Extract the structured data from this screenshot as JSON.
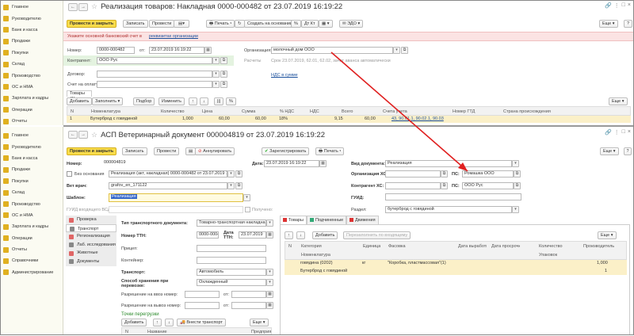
{
  "sidebar_top": [
    {
      "label": "Главное",
      "icon": "home-icon"
    },
    {
      "label": "Руководителю",
      "icon": "chart-icon"
    },
    {
      "label": "Банк и касса",
      "icon": "bank-icon"
    },
    {
      "label": "Продажи",
      "icon": "sales-icon"
    },
    {
      "label": "Покупки",
      "icon": "purchases-icon"
    },
    {
      "label": "Склад",
      "icon": "warehouse-icon"
    },
    {
      "label": "Производство",
      "icon": "production-icon"
    },
    {
      "label": "ОС и НМА",
      "icon": "assets-icon"
    },
    {
      "label": "Зарплата и кадры",
      "icon": "salary-icon"
    },
    {
      "label": "Операции",
      "icon": "operations-icon"
    },
    {
      "label": "Отчеты",
      "icon": "reports-icon"
    }
  ],
  "sidebar_bottom": [
    {
      "label": "Главное",
      "icon": "home-icon"
    },
    {
      "label": "Руководителю",
      "icon": "chart-icon"
    },
    {
      "label": "Банк и касса",
      "icon": "bank-icon"
    },
    {
      "label": "Продажи",
      "icon": "sales-icon"
    },
    {
      "label": "Покупки",
      "icon": "purchases-icon"
    },
    {
      "label": "Склад",
      "icon": "warehouse-icon"
    },
    {
      "label": "Производство",
      "icon": "production-icon"
    },
    {
      "label": "ОС и НМА",
      "icon": "assets-icon"
    },
    {
      "label": "Зарплата и кадры",
      "icon": "salary-icon"
    },
    {
      "label": "Операции",
      "icon": "operations-icon"
    },
    {
      "label": "Отчеты",
      "icon": "reports-icon"
    },
    {
      "label": "Справочники",
      "icon": "catalog-icon"
    },
    {
      "label": "Администрирование",
      "icon": "admin-icon"
    }
  ],
  "top": {
    "title": "Реализация товаров: Накладная 0000-000482 от 23.07.2019 16:19:22",
    "post_close": "Провести и закрыть",
    "write": "Записать",
    "post": "Провести",
    "print": "Печать",
    "create_based": "Создать на основании",
    "edo": "ЭДО",
    "more": "Еще",
    "help": "?",
    "warning_text": "Укажите основной банковский счет в",
    "warning_link": "реквизитах организации",
    "number_label": "Номер:",
    "number": "0000-000482",
    "from_label": "от:",
    "date": "23.07.2019 16:19:22",
    "org_label": "Организация:",
    "org": "молочный дом ООО",
    "counterparty_label": "Контрагент:",
    "counterparty": "ООО Рус",
    "settlements_label": "Расчеты",
    "settlements": "Срок 23.07.2019, 62.01, 62.02, зачет аванса автоматически",
    "contract_label": "Договор:",
    "invoice_label": "Счет на оплату:",
    "vat_link": "НДС в сумме",
    "tab_goods": "Товары (1)",
    "add": "Добавить",
    "fill": "Заполнить",
    "pick": "Подбор",
    "change": "Изменить",
    "more2": "Еще",
    "columns": [
      "N",
      "Номенклатура",
      "Количество",
      "Цена",
      "Сумма",
      "% НДС",
      "НДС",
      "Всего",
      "Счета учета",
      "Номер ГТД",
      "Страна происхождения"
    ],
    "row": {
      "n": "1",
      "item": "Бутерброд с говядиной",
      "qty": "1,000",
      "price": "60,00",
      "sum": "60,00",
      "vat_rate": "18%",
      "vat": "9,15",
      "total": "60,00",
      "accounts": "43, 90.01.1, 90.02.1, 90.03"
    }
  },
  "bottom": {
    "title": "АСП Ветеринарный документ 000004819 от 23.07.2019 16:19:22",
    "post_close": "Провести и закрыть",
    "write": "Записать",
    "post": "Провести",
    "cancel": "Аннулировать",
    "register": "Зарегистрировать",
    "print": "Печать",
    "more": "Еще",
    "help": "?",
    "number_label": "Номер:",
    "number": "000004819",
    "date_label": "Дата:",
    "date": "23.07.2019 16:19:22",
    "doc_type_label": "Вид документа:",
    "doc_type": "Реализация",
    "no_basis": "Без основания",
    "basis": "Реализация (акт, накладная) 0000-000482 от 23.07.2019 1",
    "org_hs_label": "Организация ХС:",
    "ps_label": "ПС:",
    "ps_org": "Ромашка ООО",
    "vet_label": "Вет врач:",
    "vet": "grafov_en_171122",
    "contr_hs_label": "Контрагент ХС:",
    "ps_contr": "ООО Рус",
    "template_label": "Шаблон:",
    "template": "Реализация",
    "guid_label": "ГУИД:",
    "guid_doc_label": "ГУИД входящего ВСД:",
    "received_label": "Получено:",
    "section_label": "Раздел:",
    "section": "бутерброд с говядиной",
    "left_tabs": [
      {
        "label": "Проверка",
        "color": "#e06666"
      },
      {
        "label": "Транспорт",
        "color": "#888888"
      },
      {
        "label": "Регионализация",
        "color": "#e06666"
      },
      {
        "label": "Лаб. исследования",
        "color": "#888888"
      },
      {
        "label": "Животные",
        "color": "#e06666"
      },
      {
        "label": "Документы",
        "color": "#888888"
      }
    ],
    "transport_doc_label": "Тип транспортного документа:",
    "transport_doc": "Товарно-транспортная накладна",
    "ttn_label": "Номер ТТН:",
    "ttn": "0000-000482",
    "ttn_date_label": "Дата ТТН:",
    "ttn_date": "23.07.2019",
    "trailer_label": "Прицеп:",
    "container_label": "Контейнер:",
    "transport_label": "Транспорт:",
    "transport": "Автомобиль",
    "storage_label": "Способ хранения при перевозке:",
    "storage": "Охлажденный",
    "import_label": "Разрешение на ввоз номер:",
    "export_label": "Разрешение на вывоз номер:",
    "from_label": "от:",
    "reload_label": "Точки перегрузки",
    "add": "Добавить",
    "enter_transport": "Внести транспорт",
    "more_small": "Еще",
    "reload_cols": [
      "N",
      "Название",
      "Предприя"
    ],
    "tab_goods": "Товары",
    "tab_sub": "Подчиненные",
    "tab_moves": "Движения",
    "add2": "Добавить",
    "reselect": "Перезаполнить по входящему",
    "more2": "Еще",
    "goods_cols": [
      "N",
      "Категория",
      "Единица",
      "Фасовка",
      "Дата выработки",
      "Дата просрочки",
      "Количество",
      "Производитель"
    ],
    "goods_sub": [
      "Номенклатура",
      "Упаковок"
    ],
    "row": {
      "category": "говядина (0202)",
      "unit": "кг",
      "packing": "\"Коробка, пластмассовая\"(1)",
      "qty": "1,000",
      "packs": "1",
      "item": "Бутерброд с говядиной"
    }
  }
}
